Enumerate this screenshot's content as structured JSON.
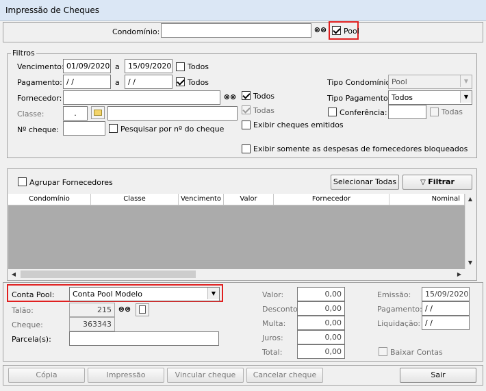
{
  "window": {
    "title": "Impressão de Cheques"
  },
  "top": {
    "condominio_label": "Condomínio:",
    "condominio_value": "",
    "pool_label": "Pool",
    "pool_checked": true
  },
  "filtros": {
    "legend": "Filtros",
    "vencimento_label": "Vencimento:",
    "vencimento_from": "01/09/2020",
    "a1": "a",
    "vencimento_to": "15/09/2020",
    "todos1": "Todos",
    "pagamento_label": "Pagamento:",
    "pagamento_from": " / /",
    "a2": "a",
    "pagamento_to": " / /",
    "todos2": "Todos",
    "fornecedor_label": "Fornecedor:",
    "todos3": "Todos",
    "classe_label": "Classe:",
    "classe_value": ".",
    "todas1": "Todas",
    "cheque_label": "Nº cheque:",
    "pesquisar_label": "Pesquisar por nº do cheque",
    "exibir_emitidos": "Exibir cheques emitidos",
    "exibir_bloqueados": "Exibir somente as despesas de fornecedores bloqueados",
    "tipo_condominio_label": "Tipo Condomínio:",
    "tipo_condominio_value": "Pool",
    "tipo_pagamento_label": "Tipo Pagamento:",
    "tipo_pagamento_value": "Todos",
    "conferencia_label": "Conferência:",
    "todas2": "Todas"
  },
  "grid": {
    "agrupar_label": "Agrupar Fornecedores",
    "selecionar_todas": "Selecionar Todas",
    "filtrar": "Filtrar",
    "columns": [
      "Condomínio",
      "Classe",
      "Vencimento",
      "Valor",
      "Fornecedor",
      "Nominal"
    ]
  },
  "bottom": {
    "conta_pool_label": "Conta Pool:",
    "conta_pool_value": "Conta Pool Modelo",
    "talao_label": "Talão:",
    "talao_value": "215",
    "cheque_label": "Cheque:",
    "cheque_value": "363343",
    "parcela_label": "Parcela(s):",
    "valor_label": "Valor:",
    "valor_value": "0,00",
    "desconto_label": "Desconto:",
    "desconto_value": "0,00",
    "multa_label": "Multa:",
    "multa_value": "0,00",
    "juros_label": "Juros:",
    "juros_value": "0,00",
    "total_label": "Total:",
    "total_value": "0,00",
    "emissao_label": "Emissão:",
    "emissao_value": "15/09/2020",
    "pagamento_label": "Pagamento:",
    "pagamento_value": " / /",
    "liquidacao_label": "Liquidação:",
    "liquidacao_value": " / /",
    "baixar_contas": "Baixar Contas"
  },
  "actions": {
    "copia": "Cópia",
    "impressao": "Impressão",
    "vincular": "Vincular cheque",
    "cancelar": "Cancelar cheque",
    "sair": "Sair"
  }
}
